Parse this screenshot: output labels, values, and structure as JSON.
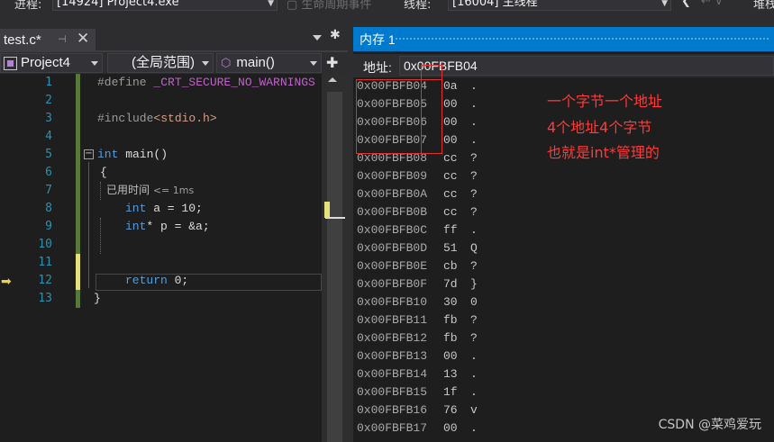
{
  "toolbar": {
    "process_label": "进程:",
    "process_value": "[14924] Project4.exe",
    "lifecycle_events": "生命周期事件",
    "thread_label": "线程:",
    "thread_value": "[16004] 主线程",
    "stack_label": "堆栈"
  },
  "editor": {
    "tab": {
      "title": "test.c*"
    },
    "nav": {
      "project": "Project4",
      "scope": "(全局范围)",
      "function": "main()"
    },
    "lines": [
      {
        "num": "1",
        "code": "#define _CRT_SECURE_NO_WARNINGS"
      },
      {
        "num": "2",
        "code": ""
      },
      {
        "num": "3",
        "code": "#include<stdio.h>"
      },
      {
        "num": "4",
        "code": ""
      },
      {
        "num": "5",
        "code": "int main()"
      },
      {
        "num": "6",
        "code": "{"
      },
      {
        "num": "7",
        "code": ""
      },
      {
        "num": "8",
        "code": "int a = 10;"
      },
      {
        "num": "9",
        "code": "int* p = &a;"
      },
      {
        "num": "10",
        "code": ""
      },
      {
        "num": "11",
        "code": ""
      },
      {
        "num": "12",
        "code": "return 0;"
      },
      {
        "num": "13",
        "code": "}"
      }
    ],
    "perf_tip": {
      "label": "已用时间",
      "value": "<= 1ms"
    }
  },
  "memory": {
    "title": "内存 1",
    "address_label": "地址:",
    "address_value": "0x00FBFB04",
    "rows": [
      {
        "addr": "0x00FBFB04",
        "hex": "0a",
        "chr": "."
      },
      {
        "addr": "0x00FBFB05",
        "hex": "00",
        "chr": "."
      },
      {
        "addr": "0x00FBFB06",
        "hex": "00",
        "chr": "."
      },
      {
        "addr": "0x00FBFB07",
        "hex": "00",
        "chr": "."
      },
      {
        "addr": "0x00FBFB08",
        "hex": "cc",
        "chr": "?"
      },
      {
        "addr": "0x00FBFB09",
        "hex": "cc",
        "chr": "?"
      },
      {
        "addr": "0x00FBFB0A",
        "hex": "cc",
        "chr": "?"
      },
      {
        "addr": "0x00FBFB0B",
        "hex": "cc",
        "chr": "?"
      },
      {
        "addr": "0x00FBFB0C",
        "hex": "ff",
        "chr": "."
      },
      {
        "addr": "0x00FBFB0D",
        "hex": "51",
        "chr": "Q"
      },
      {
        "addr": "0x00FBFB0E",
        "hex": "cb",
        "chr": "?"
      },
      {
        "addr": "0x00FBFB0F",
        "hex": "7d",
        "chr": "}"
      },
      {
        "addr": "0x00FBFB10",
        "hex": "30",
        "chr": "0"
      },
      {
        "addr": "0x00FBFB11",
        "hex": "fb",
        "chr": "?"
      },
      {
        "addr": "0x00FBFB12",
        "hex": "fb",
        "chr": "?"
      },
      {
        "addr": "0x00FBFB13",
        "hex": "00",
        "chr": "."
      },
      {
        "addr": "0x00FBFB14",
        "hex": "13",
        "chr": "."
      },
      {
        "addr": "0x00FBFB15",
        "hex": "1f",
        "chr": "."
      },
      {
        "addr": "0x00FBFB16",
        "hex": "76",
        "chr": "v"
      },
      {
        "addr": "0x00FBFB17",
        "hex": "00",
        "chr": "."
      }
    ]
  },
  "annotation": {
    "lines": [
      "一个字节一个地址",
      "4个地址4个字节",
      "也就是int*管理的"
    ],
    "color": "#ff3a3a"
  },
  "watermark": "CSDN @菜鸡爱玩",
  "colors": {
    "accent": "#007acc",
    "keyword": "#569cd6",
    "line_number": "#2b91af",
    "changed_saved": "#57783a",
    "changed_unsaved": "#e5e07a"
  }
}
